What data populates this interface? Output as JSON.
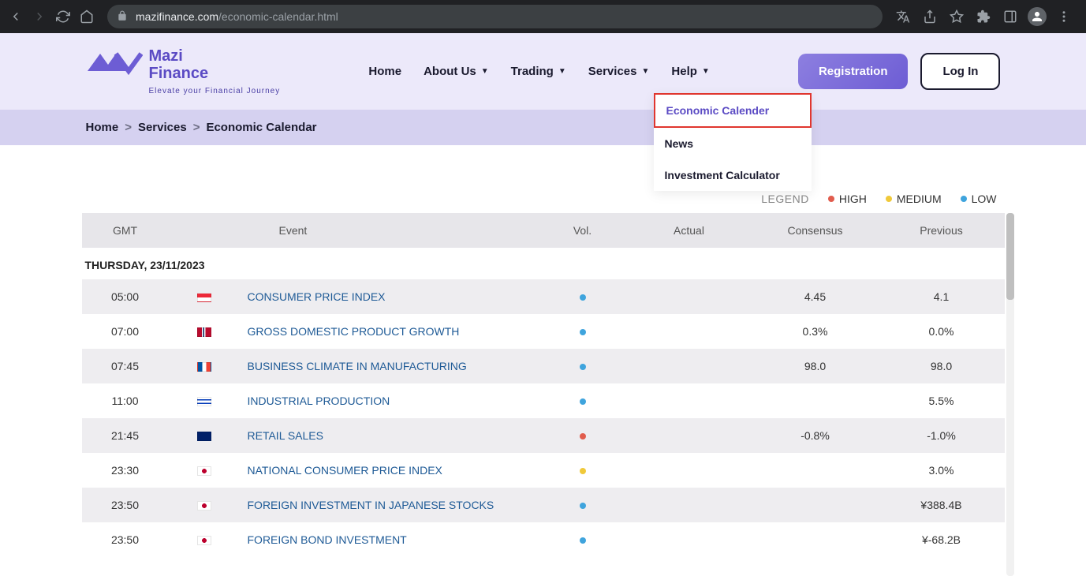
{
  "browser": {
    "url_host": "mazifinance.com",
    "url_path": "/economic-calendar.html"
  },
  "logo": {
    "title1": "Mazi",
    "title2": "Finance",
    "tagline": "Elevate your Financial Journey"
  },
  "nav": {
    "home": "Home",
    "about": "About Us",
    "trading": "Trading",
    "services": "Services",
    "help": "Help",
    "registration": "Registration",
    "login": "Log In"
  },
  "dropdown": {
    "econ": "Economic Calender",
    "news": "News",
    "calc": "Investment Calculator"
  },
  "breadcrumb": {
    "home": "Home",
    "services": "Services",
    "current": "Economic Calendar",
    "sep": ">"
  },
  "legend": {
    "label": "LEGEND",
    "high": "HIGH",
    "medium": "MEDIUM",
    "low": "LOW"
  },
  "table": {
    "headers": {
      "gmt": "GMT",
      "event": "Event",
      "vol": "Vol.",
      "actual": "Actual",
      "consensus": "Consensus",
      "previous": "Previous"
    },
    "date": "THURSDAY, 23/11/2023",
    "rows": [
      {
        "time": "05:00",
        "flag": "sg",
        "event": "CONSUMER PRICE INDEX",
        "vol": "low",
        "actual": "",
        "consensus": "4.45",
        "previous": "4.1"
      },
      {
        "time": "07:00",
        "flag": "no",
        "event": "GROSS DOMESTIC PRODUCT GROWTH",
        "vol": "low",
        "actual": "",
        "consensus": "0.3%",
        "previous": "0.0%"
      },
      {
        "time": "07:45",
        "flag": "fr",
        "event": "BUSINESS CLIMATE IN MANUFACTURING",
        "vol": "low",
        "actual": "",
        "consensus": "98.0",
        "previous": "98.0"
      },
      {
        "time": "11:00",
        "flag": "il",
        "event": "INDUSTRIAL PRODUCTION",
        "vol": "low",
        "actual": "",
        "consensus": "",
        "previous": "5.5%"
      },
      {
        "time": "21:45",
        "flag": "nz",
        "event": "RETAIL SALES",
        "vol": "high",
        "actual": "",
        "consensus": "-0.8%",
        "previous": "-1.0%"
      },
      {
        "time": "23:30",
        "flag": "jp",
        "event": "NATIONAL CONSUMER PRICE INDEX",
        "vol": "medium",
        "actual": "",
        "consensus": "",
        "previous": "3.0%"
      },
      {
        "time": "23:50",
        "flag": "jp",
        "event": "FOREIGN INVESTMENT IN JAPANESE STOCKS",
        "vol": "low",
        "actual": "",
        "consensus": "",
        "previous": "¥388.4B"
      },
      {
        "time": "23:50",
        "flag": "jp",
        "event": "FOREIGN BOND INVESTMENT",
        "vol": "low",
        "actual": "",
        "consensus": "",
        "previous": "¥-68.2B"
      }
    ]
  },
  "flags": {
    "sg": "linear-gradient(to bottom, #ed2939 50%, #fff 50%)",
    "no": "linear-gradient(to right, #ba0c2f 30%, #fff 30%, #fff 40%, #00205b 40%, #00205b 50%, #fff 50%, #fff 60%, #ba0c2f 60%)",
    "fr": "linear-gradient(to right, #0055a4 33%, #fff 33%, #fff 66%, #ef4135 66%)",
    "il": "linear-gradient(to bottom, #fff 20%, #0038b8 20%, #0038b8 35%, #fff 35%, #fff 65%, #0038b8 65%, #0038b8 80%, #fff 80%)",
    "nz": "linear-gradient(135deg, #012169 60%, #012169 100%)",
    "jp": "radial-gradient(circle at center, #bc002d 30%, #fff 32%)"
  },
  "vol_colors": {
    "low": "#3fa4dd",
    "medium": "#f0c93a",
    "high": "#e15c4d"
  }
}
